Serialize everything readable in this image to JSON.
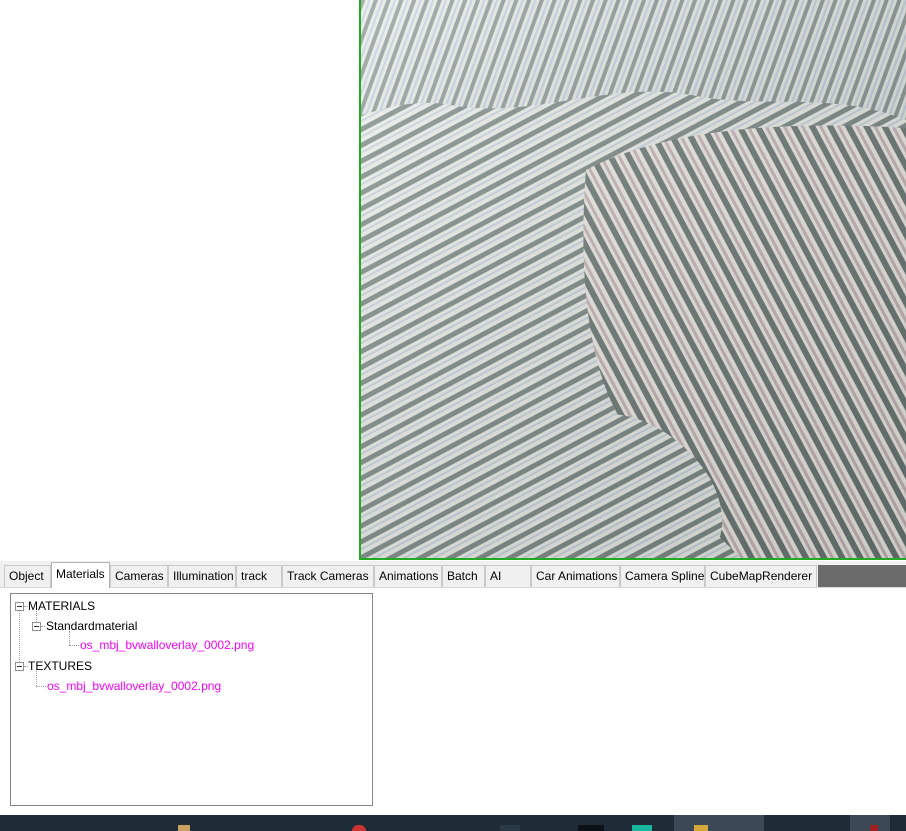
{
  "tabs": [
    {
      "label": "Object",
      "active": false
    },
    {
      "label": "Materials",
      "active": true
    },
    {
      "label": "Cameras",
      "active": false
    },
    {
      "label": "Illumination",
      "active": false
    },
    {
      "label": "track",
      "active": false
    },
    {
      "label": "Track Cameras",
      "active": false
    },
    {
      "label": "Animations",
      "active": false
    },
    {
      "label": "Batch",
      "active": false
    },
    {
      "label": "AI",
      "active": false
    },
    {
      "label": "Car Animations",
      "active": false
    },
    {
      "label": "Camera Spline",
      "active": false
    },
    {
      "label": "CubeMapRenderer",
      "active": false
    }
  ],
  "tree": {
    "materials_label": "MATERIALS",
    "standardmaterial_label": "Standardmaterial",
    "material_texture": "os_mbj_bvwalloverlay_0002.png",
    "textures_label": "TEXTURES",
    "texture_file": "os_mbj_bvwalloverlay_0002.png"
  },
  "colors": {
    "viewport_border": "#22aa22",
    "texture_text": "#ff00ff",
    "taskbar": "#1e2c37"
  }
}
